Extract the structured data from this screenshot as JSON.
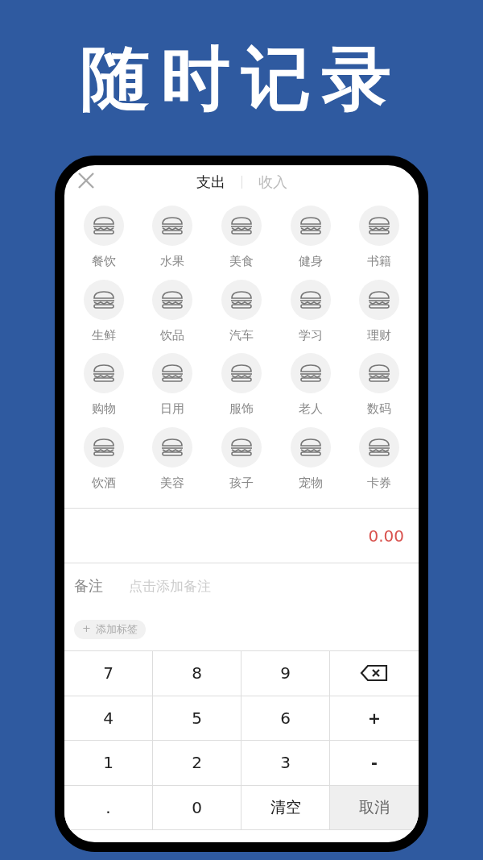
{
  "headline": "随时记录",
  "tabs": [
    {
      "label": "支出",
      "selected": true
    },
    {
      "label": "收入",
      "selected": false
    }
  ],
  "categories": [
    {
      "label": "餐饮"
    },
    {
      "label": "水果"
    },
    {
      "label": "美食"
    },
    {
      "label": "健身"
    },
    {
      "label": "书籍"
    },
    {
      "label": "生鲜"
    },
    {
      "label": "饮品"
    },
    {
      "label": "汽车"
    },
    {
      "label": "学习"
    },
    {
      "label": "理财"
    },
    {
      "label": "购物"
    },
    {
      "label": "日用"
    },
    {
      "label": "服饰"
    },
    {
      "label": "老人"
    },
    {
      "label": "数码"
    },
    {
      "label": "饮酒"
    },
    {
      "label": "美容"
    },
    {
      "label": "孩子"
    },
    {
      "label": "宠物"
    },
    {
      "label": "卡券"
    }
  ],
  "amount": "0.00",
  "note": {
    "label": "备注",
    "placeholder": "点击添加备注"
  },
  "tag_button": {
    "icon": "+",
    "label": "添加标签"
  },
  "keypad": [
    {
      "kind": "digit",
      "label": "7"
    },
    {
      "kind": "digit",
      "label": "8"
    },
    {
      "kind": "digit",
      "label": "9"
    },
    {
      "kind": "backspace"
    },
    {
      "kind": "digit",
      "label": "4"
    },
    {
      "kind": "digit",
      "label": "5"
    },
    {
      "kind": "digit",
      "label": "6"
    },
    {
      "kind": "operator",
      "label": "+"
    },
    {
      "kind": "digit",
      "label": "1"
    },
    {
      "kind": "digit",
      "label": "2"
    },
    {
      "kind": "digit",
      "label": "3"
    },
    {
      "kind": "operator",
      "label": "-"
    },
    {
      "kind": "digit",
      "label": "."
    },
    {
      "kind": "digit",
      "label": "0"
    },
    {
      "kind": "action",
      "label": "清空"
    },
    {
      "kind": "cancel",
      "label": "取消"
    }
  ]
}
